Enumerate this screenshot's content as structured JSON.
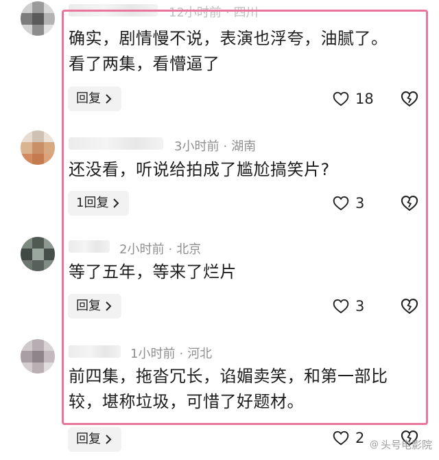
{
  "colors": {
    "frame": "#e9759a",
    "meta": "#8e8e8e",
    "reply_bg": "#f2f2f2"
  },
  "icons": {
    "like": "heart-outline-icon",
    "dislike": "broken-heart-icon",
    "reply_chevron": "chevron-right-icon"
  },
  "comments": [
    {
      "time": "12小时前",
      "location": "四川",
      "lines": [
        "确实，剧情慢不说，表演也浮夸，油腻了。",
        "看了两集，看懵逼了"
      ],
      "reply_label": "回复",
      "likes": "18"
    },
    {
      "time": "3小时前",
      "location": "湖南",
      "lines": [
        "还没看，听说给拍成了尴尬搞笑片?"
      ],
      "reply_label": "1回复",
      "likes": "3"
    },
    {
      "time": "2小时前",
      "location": "北京",
      "lines": [
        "等了五年，等来了烂片"
      ],
      "reply_label": "回复",
      "likes": "3"
    },
    {
      "time": "1小时前",
      "location": "河北",
      "lines": [
        "前四集，拖沓冗长，谄媚卖笑，和第一部比",
        "较，堪称垃圾，可惜了好题材。"
      ],
      "reply_label": "回复",
      "likes": "2"
    }
  ],
  "meta_separator": "·",
  "watermark": {
    "icon": "@",
    "text": "头号电影院"
  }
}
